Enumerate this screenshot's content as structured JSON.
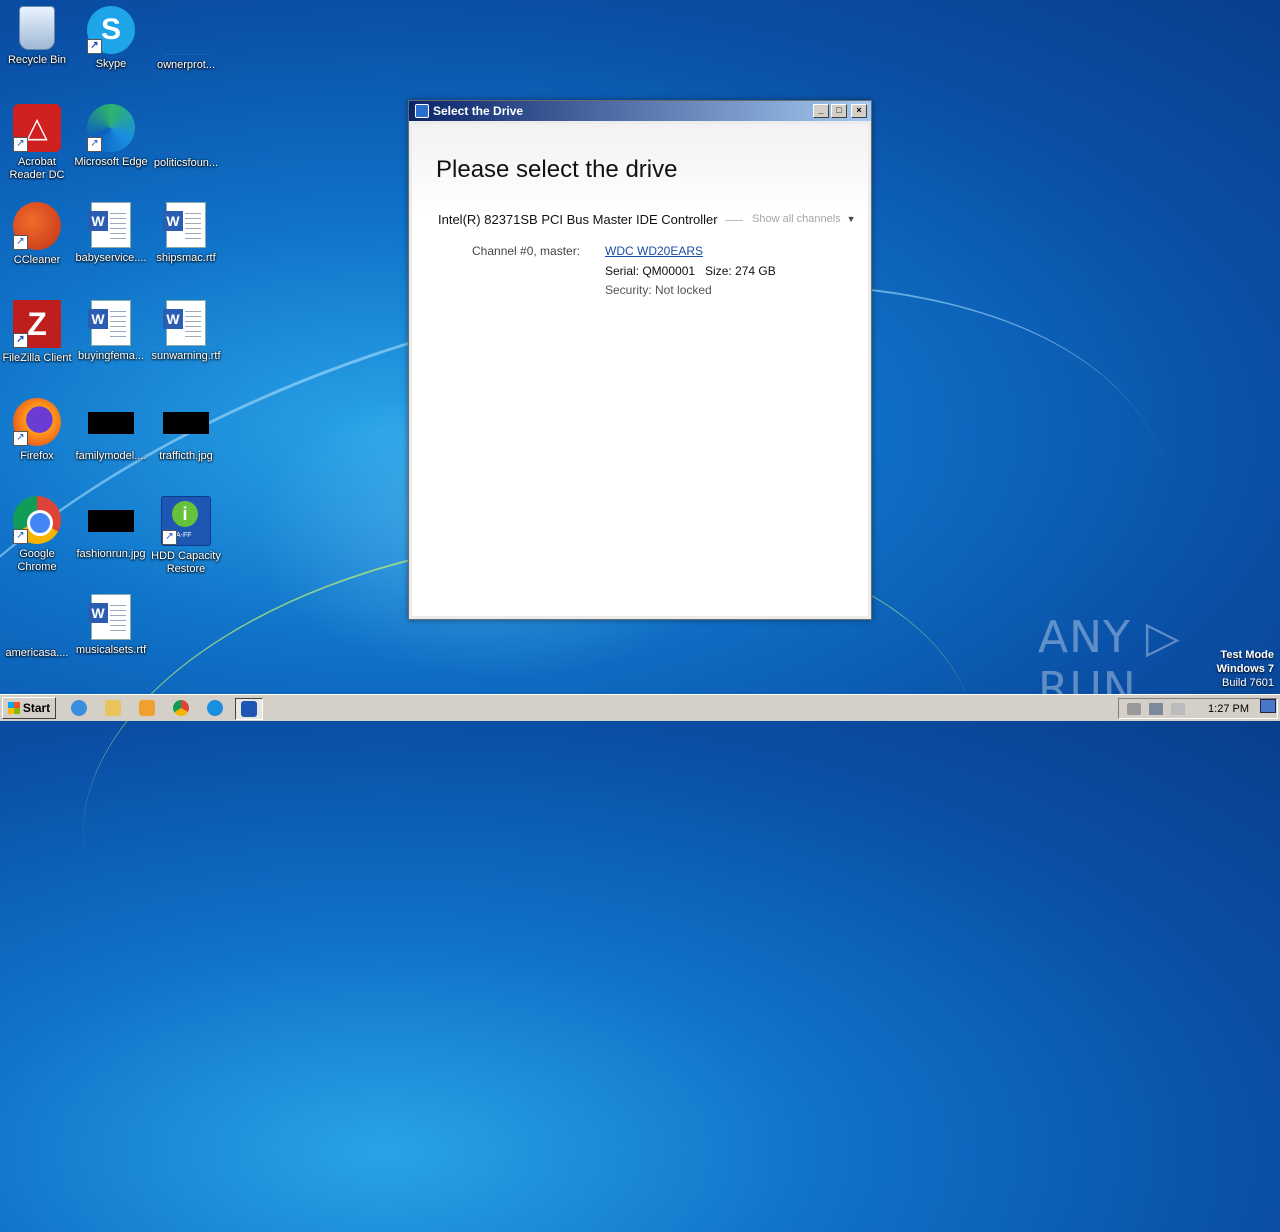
{
  "desktop": {
    "icons": [
      {
        "label": "Recycle Bin",
        "icon": "recycle-bin-icon"
      },
      {
        "label": "Skype",
        "icon": "skype-icon"
      },
      {
        "label": "ownerprot...",
        "icon": "file-icon"
      },
      {
        "label": "Acrobat Reader DC",
        "icon": "acrobat-icon"
      },
      {
        "label": "Microsoft Edge",
        "icon": "edge-icon"
      },
      {
        "label": "politicsfoun...",
        "icon": "file-icon"
      },
      {
        "label": "CCleaner",
        "icon": "ccleaner-icon"
      },
      {
        "label": "babyservice....",
        "icon": "word-document-icon"
      },
      {
        "label": "shipsmac.rtf",
        "icon": "word-document-icon"
      },
      {
        "label": "FileZilla Client",
        "icon": "filezilla-icon"
      },
      {
        "label": "buyingfema...",
        "icon": "word-document-icon"
      },
      {
        "label": "sunwarning.rtf",
        "icon": "word-document-icon"
      },
      {
        "label": "Firefox",
        "icon": "firefox-icon"
      },
      {
        "label": "familymodel....",
        "icon": "image-file-icon"
      },
      {
        "label": "trafficth.jpg",
        "icon": "image-file-icon"
      },
      {
        "label": "Google Chrome",
        "icon": "chrome-icon"
      },
      {
        "label": "fashionrun.jpg",
        "icon": "image-file-icon"
      },
      {
        "label": "HDD Capacity Restore",
        "icon": "hdd-capacity-restore-icon"
      },
      {
        "label": "americasa....",
        "icon": "file-icon"
      },
      {
        "label": "musicalsets.rtf",
        "icon": "word-document-icon"
      }
    ]
  },
  "window": {
    "title": "Select the Drive",
    "heading": "Please select the drive",
    "controller": "Intel(R) 82371SB PCI Bus Master IDE Controller",
    "show_all": "Show all channels",
    "channel_label": "Channel #0, master:",
    "drive_name": "WDC WD20EARS",
    "serial_line": "Serial: QM00001   Size: 274 GB",
    "security_line": "Security: Not locked"
  },
  "watermark": {
    "brand": "ANY ▷ RUN",
    "test_mode": "Test Mode",
    "os": "Windows 7",
    "build": "Build 7601"
  },
  "taskbar": {
    "start_label": "Start",
    "clock": "1:27 PM",
    "apps": [
      "internet-explorer-icon",
      "file-explorer-icon",
      "media-player-icon",
      "chrome-icon",
      "edge-icon",
      "hdd-capacity-restore-icon"
    ]
  }
}
